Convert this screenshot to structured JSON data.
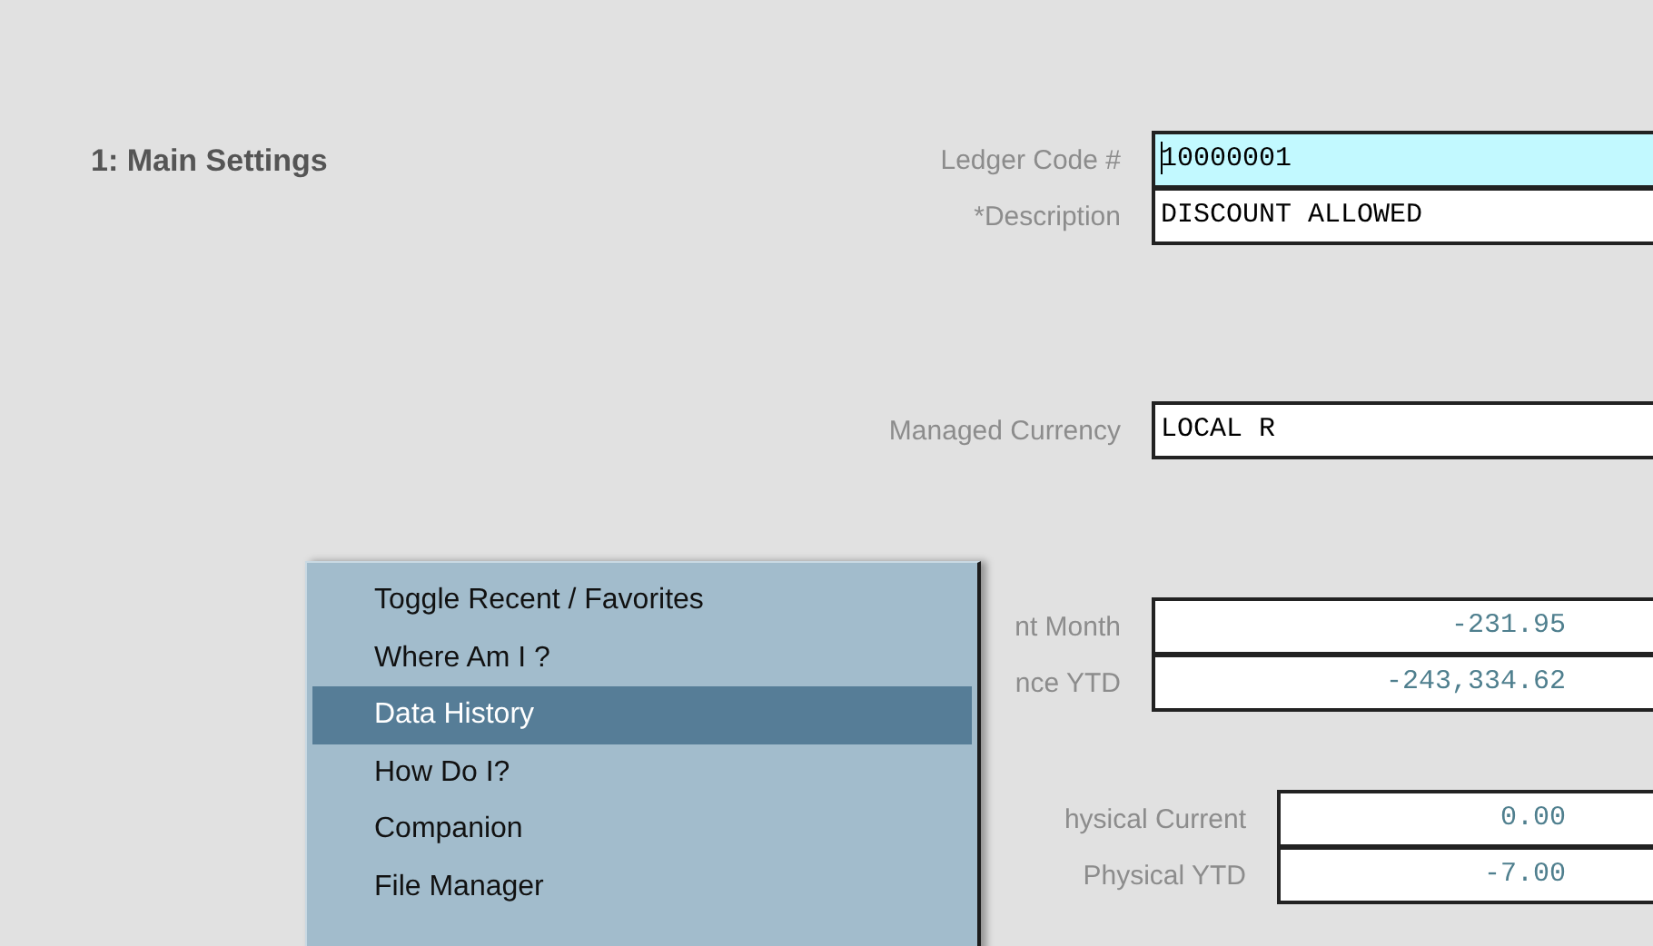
{
  "section": {
    "title": "1: Main Settings",
    "groups": [
      {
        "fields": [
          {
            "label": "Ledger Code #",
            "value": "10000001",
            "kind": "text",
            "focused": true
          },
          {
            "label": "*Description",
            "value": "DISCOUNT ALLOWED",
            "kind": "text",
            "focused": false
          }
        ]
      },
      {
        "fields": [
          {
            "label": "Managed Currency",
            "value": "LOCAL R",
            "kind": "text",
            "focused": false
          }
        ]
      },
      {
        "fields": [
          {
            "label": "nt Month",
            "value": "-231.95",
            "kind": "number",
            "focused": false
          },
          {
            "label": "nce YTD",
            "value": "-243,334.62",
            "kind": "number",
            "focused": false
          }
        ]
      },
      {
        "fields": [
          {
            "label": "hysical Current",
            "value": "0.00",
            "kind": "number",
            "focused": false
          },
          {
            "label": "Physical YTD",
            "value": "-7.00",
            "kind": "number",
            "focused": false
          }
        ]
      }
    ]
  },
  "context_menu": {
    "items": [
      {
        "label": "Toggle Recent / Favorites",
        "selected": false
      },
      {
        "label": "Where Am I ?",
        "selected": false
      },
      {
        "label": "Data History",
        "selected": true
      },
      {
        "label": "How Do I?",
        "selected": false
      },
      {
        "label": "Companion",
        "selected": false
      },
      {
        "label": "File Manager",
        "selected": false
      }
    ]
  }
}
